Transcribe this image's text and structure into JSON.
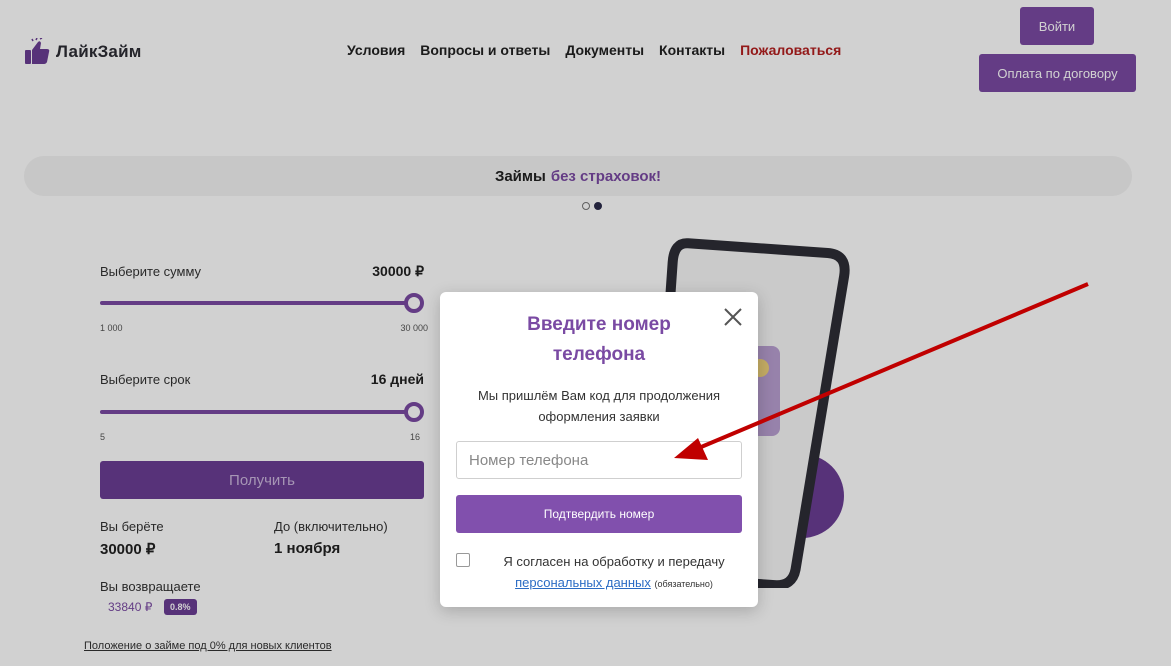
{
  "header": {
    "logo_text": "ЛайкЗайм",
    "nav": {
      "conditions": "Условия",
      "faq": "Вопросы и ответы",
      "documents": "Документы",
      "contacts": "Контакты",
      "complain": "Пожаловаться"
    },
    "login_label": "Войти",
    "pay_label": "Оплата по договору"
  },
  "banner": {
    "text": "Займы",
    "accent": "без страховок!"
  },
  "calculator": {
    "amount_label": "Выберите сумму",
    "amount_value": "30000 ₽",
    "amount_min": "1 000",
    "amount_max": "30 000",
    "amount_level": 1.0,
    "term_label": "Выберите срок",
    "term_value": "16 дней",
    "term_min": "5",
    "term_max": "16",
    "term_level": 1.0,
    "get_label": "Получить",
    "take_label": "Вы берёте",
    "take_value": "30000 ₽",
    "until_label": "До (включительно)",
    "until_value": "1 ноября",
    "return_label": "Вы возвращаете",
    "return_value": "33840 ₽",
    "rate_badge": "0.8%"
  },
  "footer_link": "Положение о займе под 0% для новых клиентов",
  "modal": {
    "title_line1": "Введите номер",
    "title_line2": "телефона",
    "desc_line1": "Мы пришлём Вам код для продолжения",
    "desc_line2": "оформления заявки",
    "phone_placeholder": "Номер телефона",
    "phone_value": "",
    "confirm_label": "Подтвердить номер",
    "consent_text": "Я согласен на обработку и передачу",
    "consent_link": "персональных данных",
    "consent_note": "(обязательно)",
    "consent_checked": false
  },
  "colors": {
    "brand": "#7a4aa3",
    "brand_dark": "#6b3d94",
    "complain": "#b41f1f",
    "link": "#2b6cc4",
    "annotation_arrow": "#c00000"
  }
}
